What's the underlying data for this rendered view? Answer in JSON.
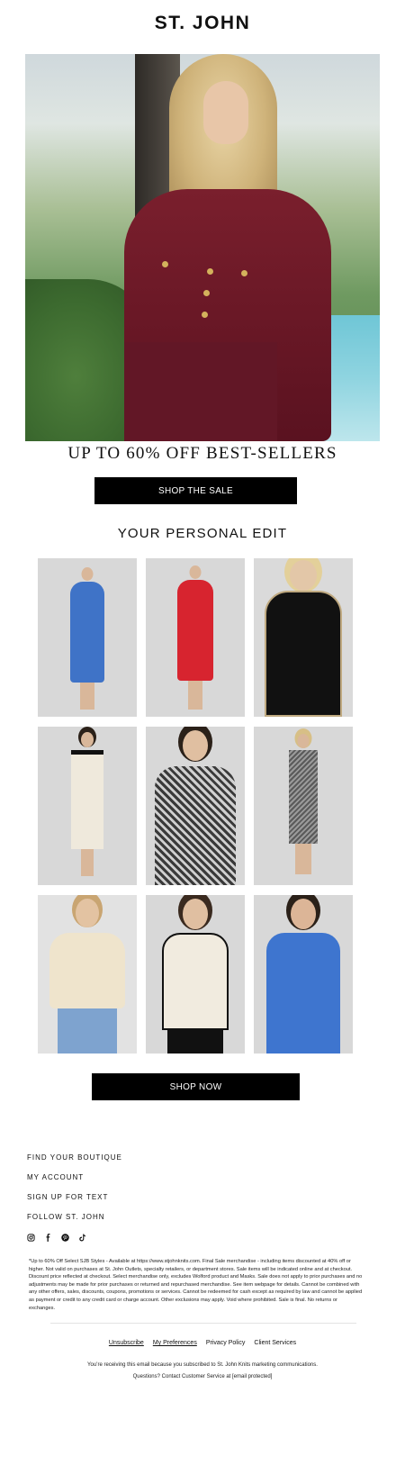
{
  "brand": {
    "logo": "ST. JOHN"
  },
  "hero": {
    "headline": "UP TO 60% OFF BEST-SELLERS",
    "cta_label": "SHOP THE SALE"
  },
  "edit": {
    "title": "YOUR PERSONAL EDIT",
    "products": [
      {
        "outfit": "blue-wrap-dress"
      },
      {
        "outfit": "red-long-dress"
      },
      {
        "outfit": "black-tweed-jacket"
      },
      {
        "outfit": "ivory-knit-dress"
      },
      {
        "outfit": "houndstooth-blazer"
      },
      {
        "outfit": "sequin-dress"
      },
      {
        "outfit": "cream-cardigan"
      },
      {
        "outfit": "ivory-blazer"
      },
      {
        "outfit": "blue-blazer-suit"
      }
    ],
    "cta_label": "SHOP NOW"
  },
  "footer": {
    "links": [
      "FIND YOUR BOUTIQUE",
      "MY ACCOUNT",
      "SIGN UP FOR TEXT",
      "FOLLOW ST. JOHN"
    ],
    "social_icons": [
      "instagram-icon",
      "facebook-icon",
      "pinterest-icon",
      "tiktok-icon"
    ],
    "disclaimer": "*Up to 60% Off Select SJB Styles - Available at https://www.stjohnknits.com. Final Sale merchandise - including items discounted at 40% off or higher. Not valid on purchases at St. John Outlets, specialty retailers, or department stores. Sale items will be indicated online and at checkout. Discount price reflected at checkout. Select merchandise only, excludes Wolford product and Masks. Sale does not apply to prior purchases and no adjustments may be made for prior purchases or returned and repurchased merchandise. See item webpage for details. Cannot be combined with any other offers, sales, discounts, coupons, promotions or services. Cannot be redeemed for cash except as required by law and cannot be applied as payment or credit to any credit card or charge account. Other exclusions may apply. Void where prohibited. Sale is final. No returns or exchanges.",
    "nav": [
      "Unsubscribe",
      "My Preferences",
      "Privacy Policy",
      "Client Services"
    ],
    "subscribed_note": "You’re receiving this email because you subscribed to St. John Knits marketing communications.",
    "questions_note": "Questions? Contact Customer Service at [email protected]"
  },
  "colors": {
    "cta_bg": "#000000",
    "cta_text": "#ffffff",
    "hero_burgundy": "#6a1826"
  }
}
